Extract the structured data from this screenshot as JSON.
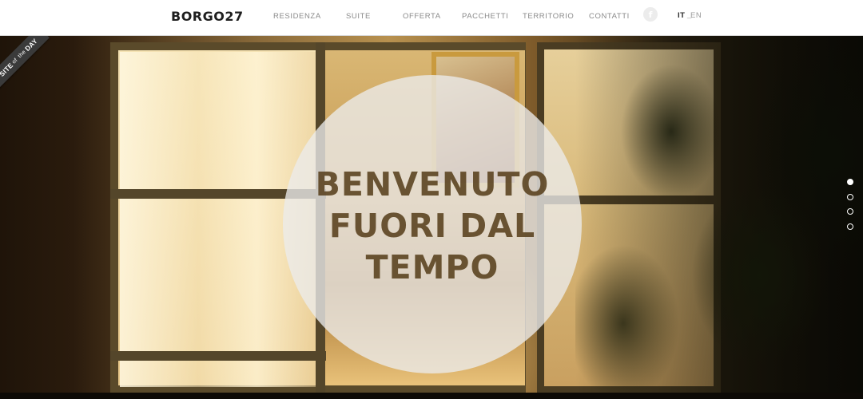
{
  "header": {
    "logo": "BORGO27",
    "nav": [
      {
        "label": "RESIDENZA"
      },
      {
        "label": "SUITE"
      },
      {
        "label": "OFFERTA"
      },
      {
        "label": "PACCHETTI"
      },
      {
        "label": "TERRITORIO"
      },
      {
        "label": "CONTATTI"
      }
    ],
    "social": {
      "icon": "facebook-icon",
      "glyph": "f"
    },
    "language": {
      "it": "IT",
      "separator": "_",
      "en": "EN",
      "active": "IT"
    }
  },
  "hero": {
    "headline": [
      "BENVENUTO",
      "FUORI DAL",
      "TEMPO"
    ],
    "slider": {
      "total": 4,
      "active": 1
    }
  },
  "badge": {
    "site": "SITE",
    "of": "of",
    "the": "the",
    "day": "DAY"
  },
  "colors": {
    "header_bg": "#ffffff",
    "nav_text": "#8a8a8a",
    "headline_text": "#58401c",
    "circle_fill": "#ececec",
    "dot_color": "#ffffff"
  }
}
